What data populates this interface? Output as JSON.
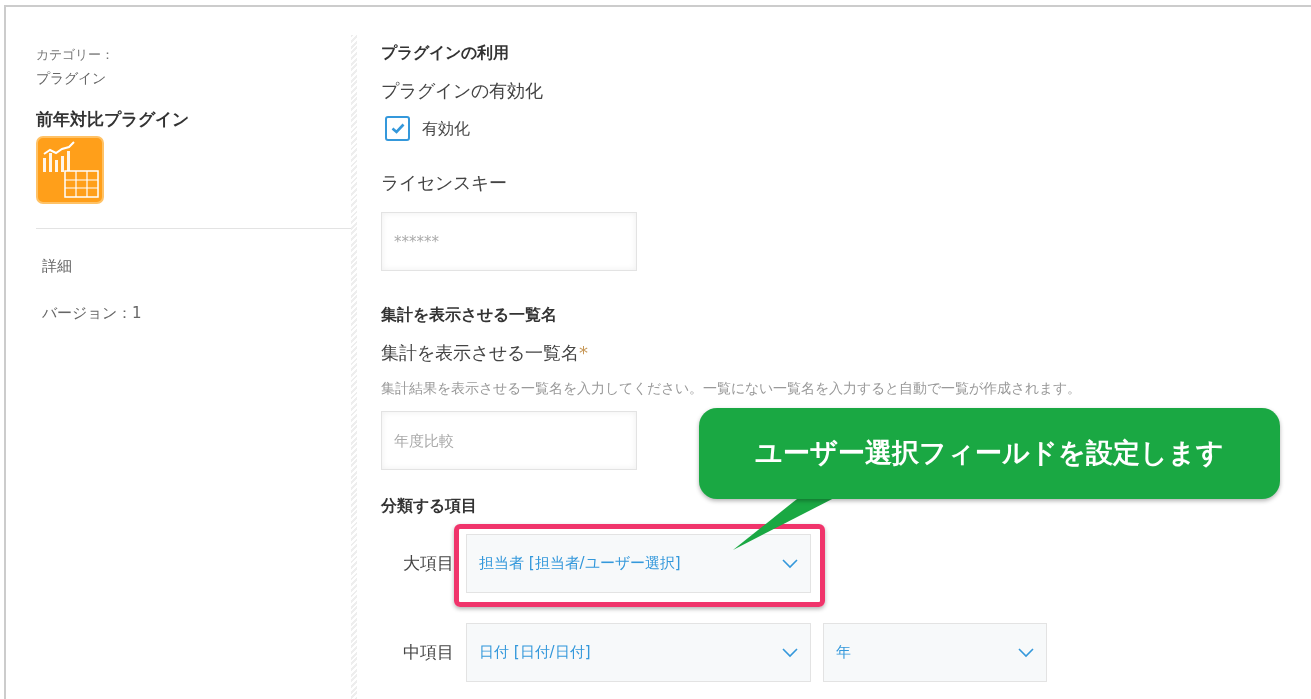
{
  "sidebar": {
    "category_label": "カテゴリー：",
    "category_value": "プラグイン",
    "plugin_name": "前年対比プラグイン",
    "links": [
      {
        "label": "詳細"
      },
      {
        "label": "バージョン：1"
      }
    ]
  },
  "sections": [
    {
      "heading": "プラグインの利用",
      "fields": [
        {
          "kind": "checkbox",
          "label": "プラグインの有効化",
          "option": "有効化",
          "checked": true
        },
        {
          "kind": "text",
          "label": "ライセンスキー",
          "placeholder": "******"
        }
      ]
    },
    {
      "heading": "集計を表示させる一覧名",
      "fields": [
        {
          "kind": "text",
          "label": "集計を表示させる一覧名",
          "required_mark": "*",
          "hint": "集計結果を表示させる一覧名を入力してください。一覧にない一覧名を入力すると自動で一覧が作成されます。",
          "placeholder": "年度比較"
        }
      ]
    },
    {
      "heading": "分類する項目",
      "fields": [
        {
          "kind": "selects",
          "label": "大項目",
          "highlighted": true,
          "values": [
            "担当者 [担当者/ユーザー選択]"
          ]
        },
        {
          "kind": "selects",
          "label": "中項目",
          "highlighted": false,
          "values": [
            "日付 [日付/日付]",
            "年"
          ]
        }
      ]
    }
  ],
  "callout": {
    "text": "ユーザー選択フィールドを設定します"
  }
}
